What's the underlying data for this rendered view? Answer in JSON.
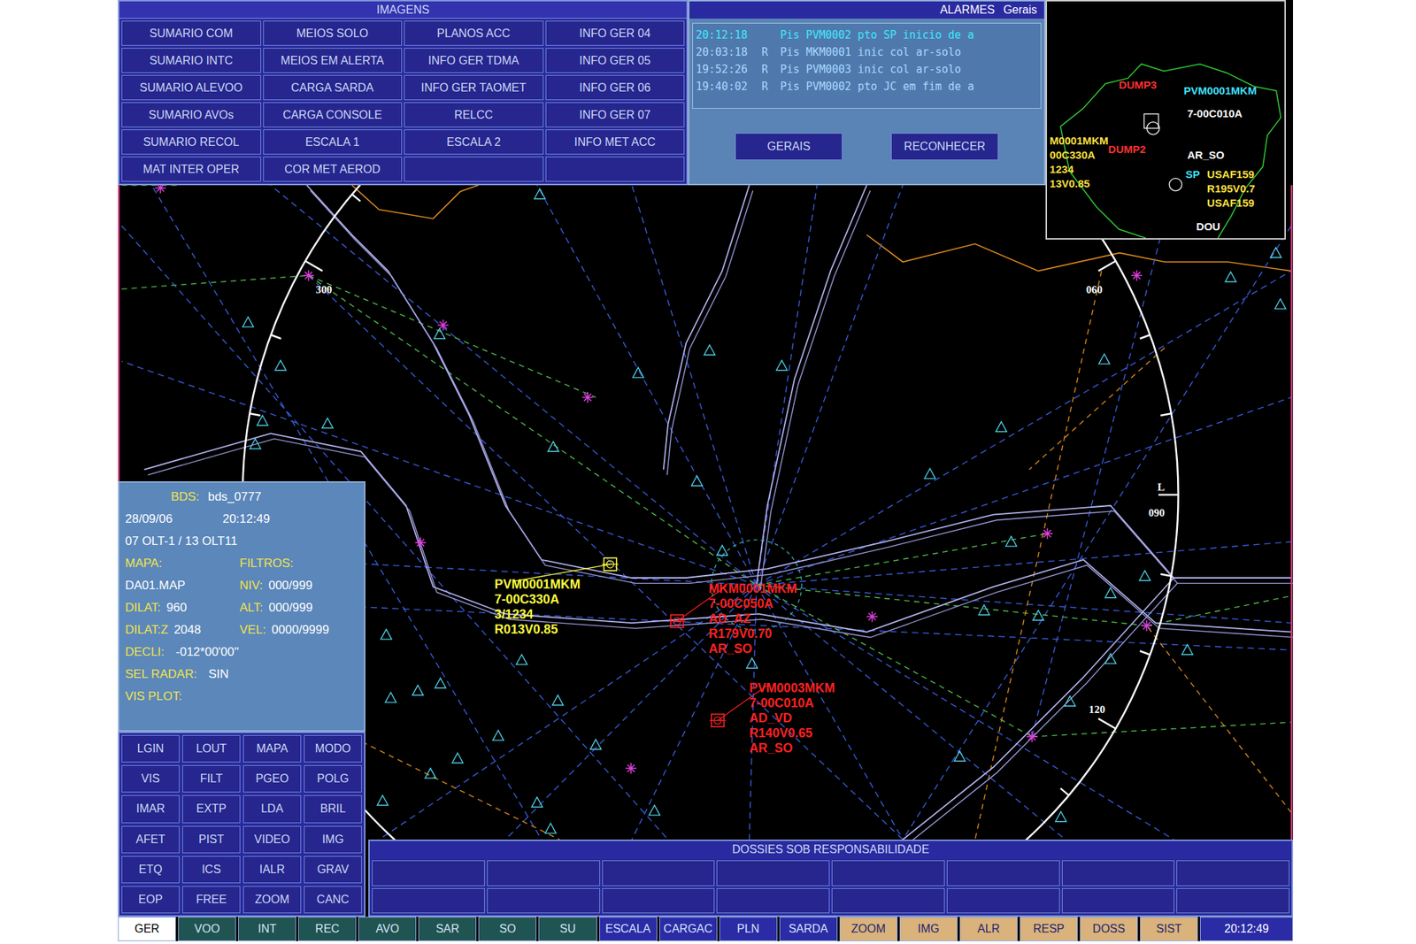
{
  "images_panel": {
    "title": "IMAGENS",
    "buttons": [
      [
        "SUMARIO COM",
        "MEIOS SOLO",
        "PLANOS ACC",
        "INFO GER 04"
      ],
      [
        "SUMARIO INTC",
        "MEIOS EM ALERTA",
        "INFO GER TDMA",
        "INFO GER 05"
      ],
      [
        "SUMARIO ALEVOO",
        "CARGA SARDA",
        "INFO GER TAOMET",
        "INFO GER 06"
      ],
      [
        "SUMARIO AVOs",
        "CARGA CONSOLE",
        "RELCC",
        "INFO GER 07"
      ],
      [
        "SUMARIO RECOL",
        "ESCALA 1",
        "ESCALA 2",
        "INFO MET ACC"
      ],
      [
        "MAT INTER OPER",
        "COR MET AEROD",
        "",
        ""
      ]
    ]
  },
  "alarms": {
    "title": "ALARMES",
    "filter": "Gerais",
    "rows": [
      {
        "time": "20:12:18",
        "flag": "",
        "text": "Pis PVM0002 pto SP inicio de a",
        "recognized": false
      },
      {
        "time": "20:03:18",
        "flag": "R",
        "text": "Pis MKM0001 inic col ar-solo",
        "recognized": true
      },
      {
        "time": "19:52:26",
        "flag": "R",
        "text": "Pis PVM0003 inic col ar-solo",
        "recognized": true
      },
      {
        "time": "19:40:02",
        "flag": "R",
        "text": "Pis PVM0002 pto JC em fim de a",
        "recognized": true
      }
    ],
    "buttons": [
      "GERAIS",
      "RECONHECER"
    ]
  },
  "minimap": {
    "labels": [
      {
        "text": "DUMP3",
        "color": "#ff3030"
      },
      {
        "text": "PVM0001MKM",
        "color": "#40e0ff"
      },
      {
        "text": "7-00C010A",
        "color": "#ffffff"
      },
      {
        "text": "M0001MKM",
        "color": "#ffe040"
      },
      {
        "text": "00C330A",
        "color": "#ffe040"
      },
      {
        "text": "1234",
        "color": "#ffe040"
      },
      {
        "text": "13V0.85",
        "color": "#ffe040"
      },
      {
        "text": "DUMP2",
        "color": "#ff3030"
      },
      {
        "text": "AR_SO",
        "color": "#ffffff"
      },
      {
        "text": "SP",
        "color": "#40e0ff"
      },
      {
        "text": "USAF159",
        "color": "#ffe040"
      },
      {
        "text": "R195V0.7",
        "color": "#ffe040"
      },
      {
        "text": "USAF159",
        "color": "#ffe040"
      },
      {
        "text": "DOU",
        "color": "#ffffff"
      }
    ]
  },
  "radar": {
    "ring_labels": [
      "300",
      "060",
      "L",
      "090",
      "120"
    ],
    "tracks": [
      {
        "lines": [
          "PVM0001MKM",
          "7-00C330A",
          "3/1234",
          "R013V0.85"
        ],
        "color": "#ffff40"
      },
      {
        "lines": [
          "MKM0001MKM",
          "7-00C050A",
          "AD_AZ",
          "R179V0.70",
          "AR_SO"
        ],
        "color": "#ff2020"
      },
      {
        "lines": [
          "PVM0003MKM",
          "7-00C010A",
          "AD_VD",
          "R140V0.65",
          "AR_SO"
        ],
        "color": "#ff2020"
      }
    ]
  },
  "info": {
    "bds_label": "BDS:",
    "bds": "bds_0777",
    "date": "28/09/06",
    "time": "20:12:49",
    "olt": "07 OLT-1 / 13 OLT11",
    "map_label": "MAPA:",
    "filters_label": "FILTROS:",
    "pairs": [
      {
        "left_label": "",
        "left_value": "DA01.MAP",
        "right_label": "NIV:",
        "right_value": "000/999"
      },
      {
        "left_label": "DILAT:",
        "left_value": "960",
        "right_label": "ALT:",
        "right_value": "000/999"
      },
      {
        "left_label": "DILAT:Z",
        "left_value": "2048",
        "right_label": "VEL:",
        "right_value": "0000/9999"
      }
    ],
    "fields": [
      {
        "label": "DECLI:",
        "value": "-012*00'00''"
      },
      {
        "label": "SEL RADAR:",
        "value": "SIN"
      },
      {
        "label": "VIS PLOT:",
        "value": ""
      }
    ]
  },
  "commands": [
    "LGIN",
    "LOUT",
    "MAPA",
    "MODO",
    "VIS",
    "FILT",
    "PGEO",
    "POLG",
    "IMAR",
    "EXTP",
    "LDA",
    "BRIL",
    "AFET",
    "PIST",
    "VIDEO",
    "IMG",
    "ETQ",
    "ICS",
    "IALR",
    "GRAV",
    "EOP",
    "FREE",
    "ZOOM",
    "CANC"
  ],
  "dossiers": {
    "title": "DOSSIES SOB RESPONSABILIDADE",
    "cells": [
      [
        "",
        "",
        "",
        "",
        "",
        "",
        "",
        ""
      ],
      [
        "",
        "",
        "",
        "",
        "",
        "",
        "",
        ""
      ]
    ]
  },
  "tabs": [
    {
      "label": "GER",
      "selected": true,
      "color": "#ffffff"
    },
    {
      "label": "VOO",
      "selected": false,
      "color": "#1f5452"
    },
    {
      "label": "INT",
      "selected": false,
      "color": "#1f5452"
    },
    {
      "label": "REC",
      "selected": false,
      "color": "#1f5452"
    },
    {
      "label": "AVO",
      "selected": false,
      "color": "#1f5452"
    },
    {
      "label": "SAR",
      "selected": false,
      "color": "#1f5452"
    },
    {
      "label": "SO",
      "selected": false,
      "color": "#1f5452"
    },
    {
      "label": "SU",
      "selected": false,
      "color": "#1f5452"
    },
    {
      "label": "ESCALA",
      "selected": false,
      "color": "#2b2ba6"
    },
    {
      "label": "CARGAC",
      "selected": false,
      "color": "#2b2ba6"
    },
    {
      "label": "PLN",
      "selected": false,
      "color": "#2b2ba6"
    },
    {
      "label": "SARDA",
      "selected": false,
      "color": "#2b2ba6"
    },
    {
      "label": "ZOOM",
      "selected": false,
      "color": "#d9b27c"
    },
    {
      "label": "IMG",
      "selected": false,
      "color": "#d9b27c"
    },
    {
      "label": "ALR",
      "selected": false,
      "color": "#d9b27c"
    },
    {
      "label": "RESP",
      "selected": false,
      "color": "#d9b27c"
    },
    {
      "label": "DOSS",
      "selected": false,
      "color": "#d9b27c"
    },
    {
      "label": "SIST",
      "selected": false,
      "color": "#d9b27c"
    }
  ],
  "clock": "20:12:49"
}
